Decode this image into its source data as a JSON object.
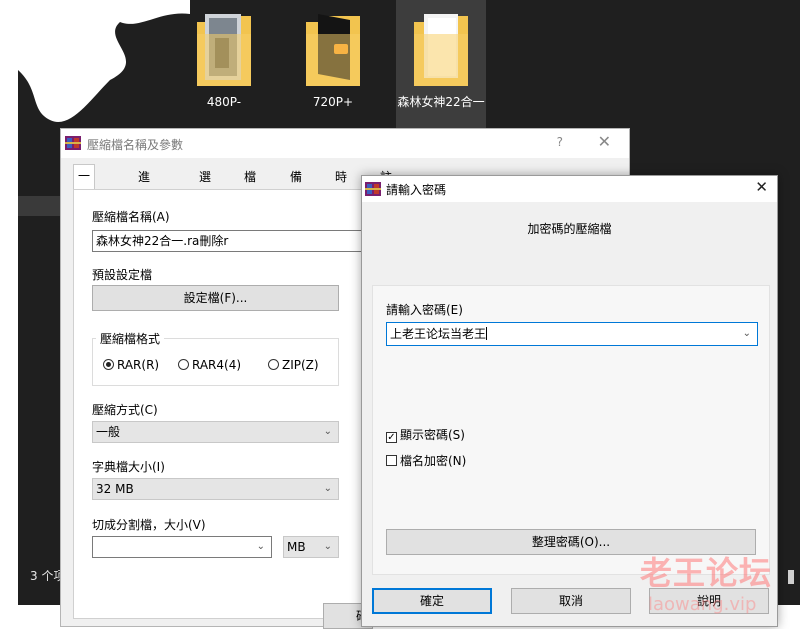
{
  "explorer": {
    "folders": [
      {
        "name": "480P-"
      },
      {
        "name": "720P+"
      },
      {
        "name": "森林女神22合一"
      }
    ],
    "status": "3 个项"
  },
  "archive_dialog": {
    "title": "壓縮檔名稱及參數",
    "help": "?",
    "close": "✕",
    "tabs": [
      "一般設定",
      "進階設定",
      "選項",
      "檔案",
      "備份",
      "時間",
      "註解"
    ],
    "archive_name_label": "壓縮檔名稱(A)",
    "archive_name_value": "森林女神22合一.ra刪除r",
    "profile_label": "預設設定檔",
    "profile_button": "設定檔(F)...",
    "format_group_label": "壓縮檔格式",
    "formats": [
      "RAR(R)",
      "RAR4(4)",
      "ZIP(Z)"
    ],
    "selected_format": "RAR(R)",
    "method_label": "壓縮方式(C)",
    "method_value": "一般",
    "dict_label": "字典檔大小(I)",
    "dict_value": "32 MB",
    "split_label": "切成分割檔，大小(V)",
    "split_value": "",
    "split_unit": "MB",
    "ok_partial": "確"
  },
  "password_dialog": {
    "title": "請輸入密碼",
    "close": "✕",
    "subtitle": "加密碼的壓縮檔",
    "password_label": "請輸入密碼(E)",
    "password_value": "上老王论坛当老王",
    "show_password_label": "顯示密碼(S)",
    "show_password_checked": true,
    "encrypt_names_label": "檔名加密(N)",
    "encrypt_names_checked": false,
    "organize_button": "整理密碼(O)...",
    "ok_button": "確定",
    "cancel_button": "取消",
    "help_button": "說明"
  },
  "watermark": {
    "line1": "老王论坛",
    "line2": "laowang.vip"
  },
  "colors": {
    "explorer_bg": "#1f1f1f",
    "dialog_bg": "#f0f0f0",
    "focus_blue": "#0078d7"
  }
}
